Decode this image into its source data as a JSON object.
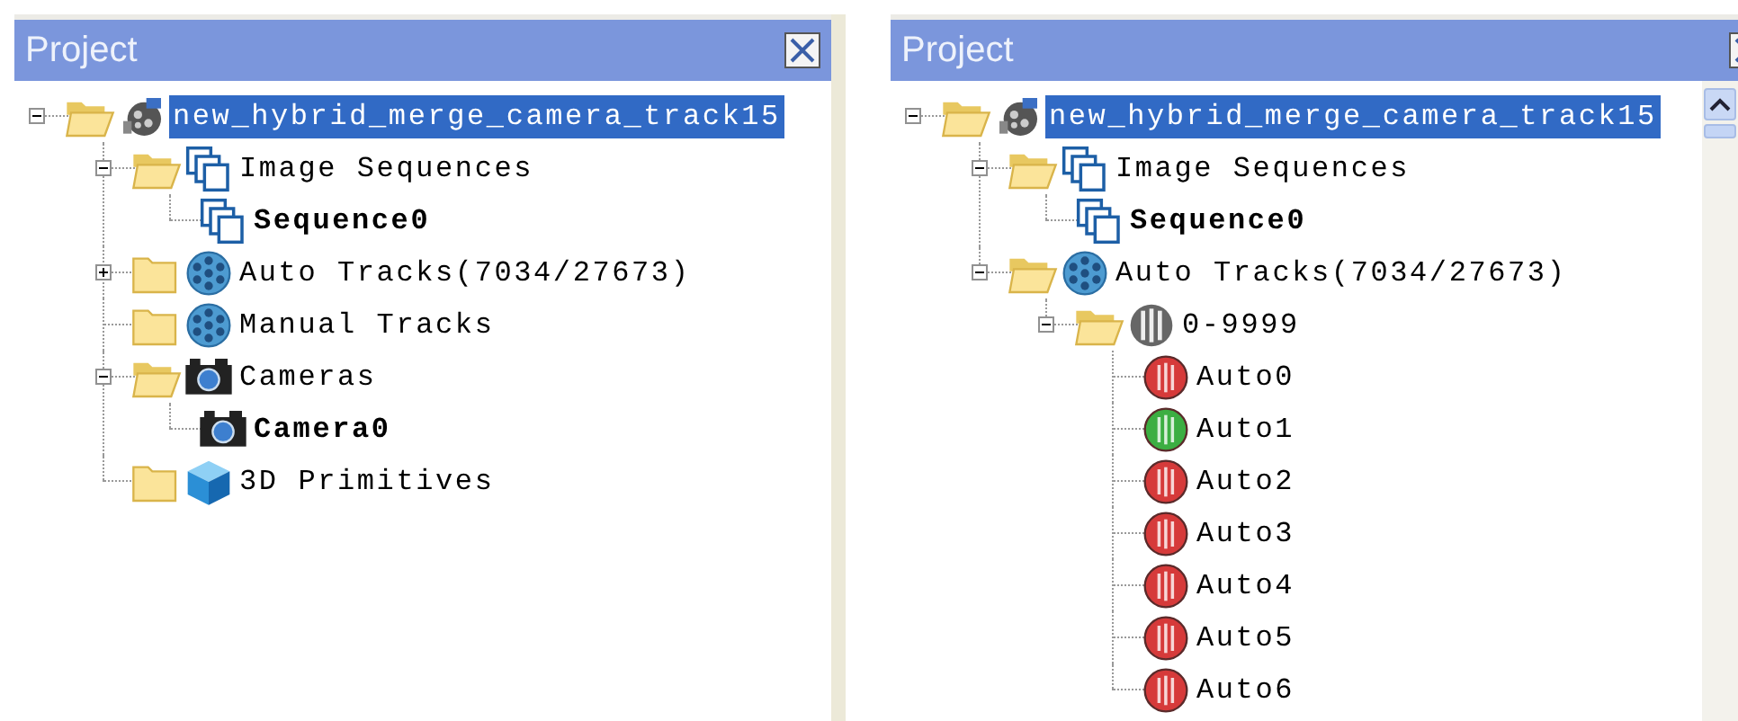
{
  "panels": [
    {
      "title": "Project",
      "scrollbar": false,
      "tree": [
        {
          "label": "new_hybrid_merge_camera_track15",
          "kind": "project",
          "folder": true,
          "expanded": true,
          "selected": true,
          "bold": false,
          "children": [
            {
              "label": "Image Sequences",
              "kind": "sequences",
              "folder": true,
              "expanded": true,
              "selected": false,
              "bold": false,
              "children": [
                {
                  "label": "Sequence0",
                  "kind": "sequences",
                  "folder": false,
                  "selected": false,
                  "bold": true
                }
              ]
            },
            {
              "label": "Auto Tracks(7034/27673)",
              "kind": "tracks",
              "folder": true,
              "expanded": false,
              "selected": false,
              "bold": false
            },
            {
              "label": "Manual Tracks",
              "kind": "tracks",
              "folder": true,
              "selected": false,
              "bold": false
            },
            {
              "label": "Cameras",
              "kind": "camera",
              "folder": true,
              "expanded": true,
              "selected": false,
              "bold": false,
              "children": [
                {
                  "label": "Camera0",
                  "kind": "camera",
                  "folder": false,
                  "selected": false,
                  "bold": true
                }
              ]
            },
            {
              "label": "3D Primitives",
              "kind": "cube",
              "folder": true,
              "selected": false,
              "bold": false
            }
          ]
        }
      ]
    },
    {
      "title": "Project",
      "scrollbar": true,
      "tree": [
        {
          "label": "new_hybrid_merge_camera_track15",
          "kind": "project",
          "folder": true,
          "expanded": true,
          "selected": true,
          "bold": false,
          "children": [
            {
              "label": "Image Sequences",
              "kind": "sequences",
              "folder": true,
              "expanded": true,
              "selected": false,
              "bold": false,
              "children": [
                {
                  "label": "Sequence0",
                  "kind": "sequences",
                  "folder": false,
                  "selected": false,
                  "bold": true
                }
              ]
            },
            {
              "label": "Auto Tracks(7034/27673)",
              "kind": "tracks",
              "folder": true,
              "expanded": true,
              "selected": false,
              "bold": false,
              "children": [
                {
                  "label": "0-9999",
                  "kind": "track-group",
                  "folder": true,
                  "expanded": true,
                  "selected": false,
                  "bold": false,
                  "children": [
                    {
                      "label": "Auto0",
                      "kind": "track",
                      "color": "#d63a3a",
                      "folder": false,
                      "selected": false,
                      "bold": false
                    },
                    {
                      "label": "Auto1",
                      "kind": "track",
                      "color": "#3cae42",
                      "folder": false,
                      "selected": false,
                      "bold": false
                    },
                    {
                      "label": "Auto2",
                      "kind": "track",
                      "color": "#d63a3a",
                      "folder": false,
                      "selected": false,
                      "bold": false
                    },
                    {
                      "label": "Auto3",
                      "kind": "track",
                      "color": "#d63a3a",
                      "folder": false,
                      "selected": false,
                      "bold": false
                    },
                    {
                      "label": "Auto4",
                      "kind": "track",
                      "color": "#d63a3a",
                      "folder": false,
                      "selected": false,
                      "bold": false
                    },
                    {
                      "label": "Auto5",
                      "kind": "track",
                      "color": "#d63a3a",
                      "folder": false,
                      "selected": false,
                      "bold": false
                    },
                    {
                      "label": "Auto6",
                      "kind": "track",
                      "color": "#d63a3a",
                      "folder": false,
                      "selected": false,
                      "bold": false
                    }
                  ]
                }
              ]
            }
          ]
        }
      ]
    }
  ]
}
